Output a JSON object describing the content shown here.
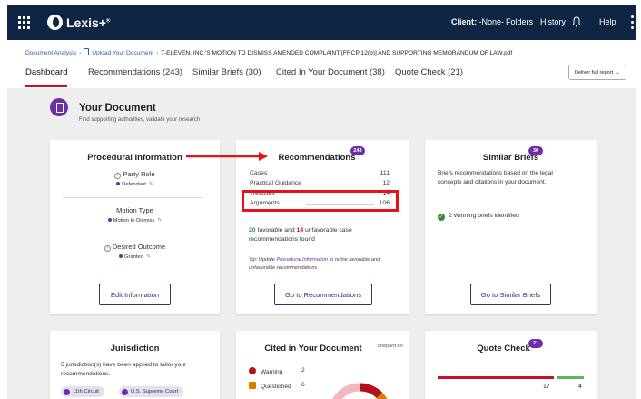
{
  "topbar": {
    "brand": "Lexis+",
    "brand_mark": "®",
    "client_label": "Client:",
    "client_value": "-None-",
    "nav": [
      {
        "label": "Folders"
      },
      {
        "label": "History"
      },
      {
        "label": "Help"
      }
    ],
    "icons": [
      "grid-icon",
      "lexis-logo-icon",
      "bell-icon",
      "kebab-menu-icon"
    ]
  },
  "breadcrumb": {
    "items": [
      {
        "label": "Document Analysis"
      },
      {
        "label": "Upload Your Document"
      }
    ],
    "current": "7-ELEVEN, INC.'S MOTION TO DISMISS AMENDED COMPLAINT [FRCP 12(b)] AND SUPPORTING MEMORANDUM OF LAW.pdf"
  },
  "tabs": [
    {
      "label": "Dashboard",
      "active": true
    },
    {
      "label": "Recommendations (243)",
      "active": false
    },
    {
      "label": "Similar Briefs (30)",
      "active": false
    },
    {
      "label": "Cited In Your Document (38)",
      "active": false
    },
    {
      "label": "Quote Check (21)",
      "active": false
    }
  ],
  "deliver_button": {
    "label": "Deliver full report",
    "icon": "chevron-down-icon"
  },
  "your_document": {
    "title": "Your Document",
    "subtitle": "Find supporting authorities, validate your research",
    "icon": "document-icon"
  },
  "procedural": {
    "title": "Procedural Information",
    "fields": [
      {
        "label": "Party Role",
        "value": "Defendant"
      },
      {
        "label": "Motion Type",
        "value": "Motion to Dismiss"
      },
      {
        "label": "Desired Outcome",
        "value": "Granted"
      }
    ],
    "button": "Edit Information"
  },
  "recommendations": {
    "title": "Recommendations",
    "badge": "243",
    "rows": [
      {
        "label": "Cases",
        "value": "111"
      },
      {
        "label": "Practical Guidance",
        "value": "12"
      },
      {
        "label": "Treatises",
        "value": "14"
      },
      {
        "label": "Arguments",
        "value": "106"
      }
    ],
    "favorable": "20",
    "favorable_text": "favorable and",
    "unfavorable": "14",
    "unfavorable_text": "unfavorable case recommendations found",
    "tip_prefix": "Tip: Update",
    "tip_link": "Procedural Information",
    "tip_suffix": "to refine favorable and unfavorable recommendations",
    "button": "Go to Recommendations"
  },
  "similar_briefs": {
    "title": "Similar Briefs",
    "badge": "30",
    "description": "Briefs recommendations based on the legal concepts and citations in your document.",
    "item": "2 Winning briefs identified",
    "button": "Go to Similar Briefs"
  },
  "jurisdiction": {
    "title": "Jurisdiction",
    "description": "5 jurisdiction(s) have been applied to tailor your recommendations.",
    "chips": [
      {
        "label": "11th Circuit"
      },
      {
        "label": "U.S. Supreme Court"
      }
    ]
  },
  "cited": {
    "title": "Cited in Your Document",
    "shepards": "Shepard's®",
    "rows": [
      {
        "label": "Warning",
        "count": "2",
        "color": "#b3121d"
      },
      {
        "label": "Questioned",
        "count": "6",
        "color": "#e07b00"
      }
    ],
    "donut_colors": [
      "#b3121d",
      "#e07b00",
      "#f2b8c0"
    ]
  },
  "quote_check": {
    "title": "Quote Check",
    "badge": "21",
    "red_count": "17",
    "green_count": "4",
    "red_fraction": 0.81,
    "green_fraction": 0.19,
    "colors": {
      "red": "#c8102e",
      "green": "#5cb85c"
    }
  },
  "colors": {
    "navy": "#0f2544",
    "accent_purple": "#6b2fa8",
    "tab_underline": "#c8102e",
    "highlight": "#e8101a"
  }
}
